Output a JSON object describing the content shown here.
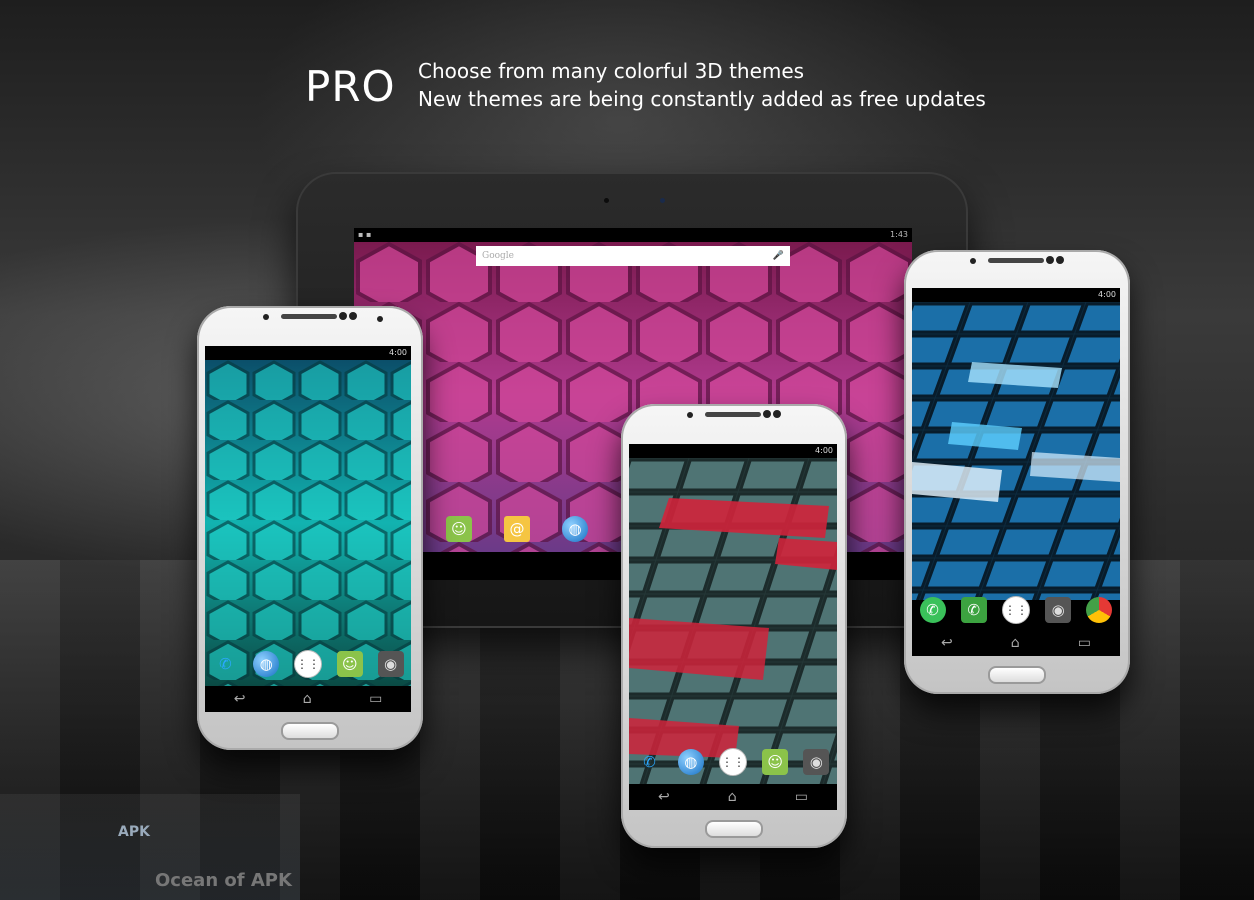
{
  "header": {
    "badge": "PRO",
    "line1": "Choose from many colorful 3D themes",
    "line2": "New themes are being constantly added as free updates"
  },
  "tablet": {
    "status_time": "1:43",
    "search_placeholder": "Google",
    "mic_icon": "microphone-icon",
    "dock": [
      "messenger-icon",
      "email-icon",
      "browser-globe-icon"
    ],
    "nav_back": "↩",
    "wallpaper_theme": "pink-hexagons"
  },
  "phone_left": {
    "status_time": "4:00",
    "wallpaper_theme": "teal-hexagons",
    "dock": [
      "phone-icon",
      "browser-globe-icon",
      "apps-icon",
      "messenger-icon",
      "camera-icon"
    ],
    "nav": [
      "↩",
      "⌂",
      "▭"
    ]
  },
  "phone_center": {
    "status_time": "4:00",
    "wallpaper_theme": "red-grey-tiles",
    "dock": [
      "phone-icon",
      "browser-globe-icon",
      "apps-icon",
      "messenger-icon",
      "camera-icon"
    ],
    "nav": [
      "↩",
      "⌂",
      "▭"
    ]
  },
  "phone_right": {
    "status_time": "4:00",
    "wallpaper_theme": "blue-tiles",
    "dock": [
      "whatsapp-icon",
      "phone-icon",
      "apps-icon",
      "camera-icon",
      "chrome-icon"
    ],
    "nav": [
      "↩",
      "⌂",
      "▭"
    ]
  },
  "watermark": {
    "brand": "Ocean of APK",
    "logo_text": "APK"
  },
  "colors": {
    "pink_hex": "#c23a8c",
    "teal_hex": "#1bb8b8",
    "red_tile": "#d0233b",
    "blue_tile": "#1b7fc0"
  }
}
